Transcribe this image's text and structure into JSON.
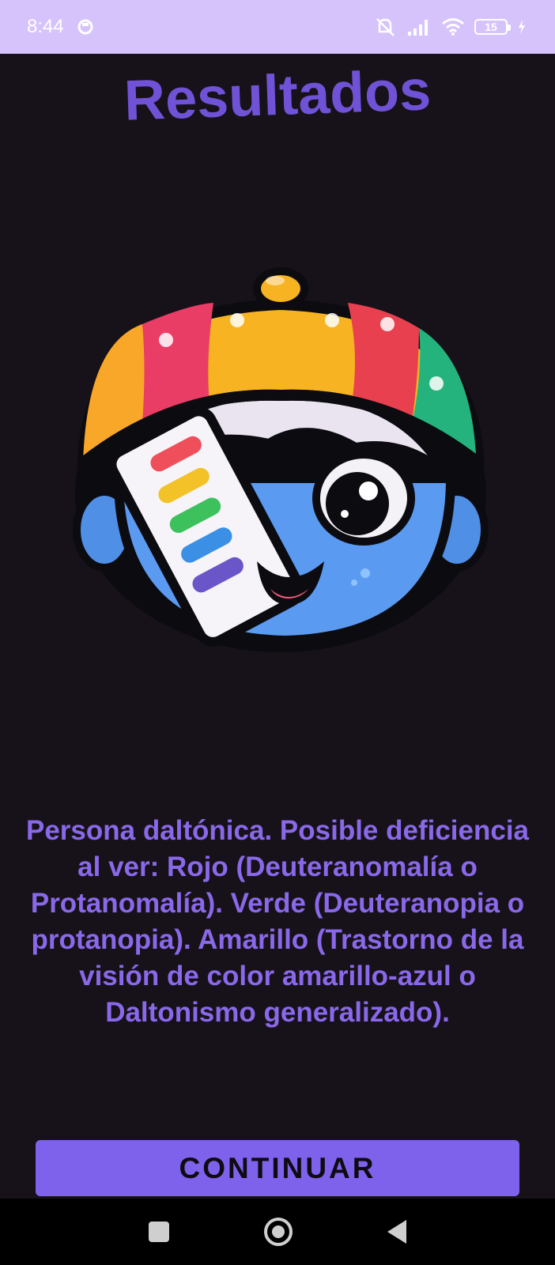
{
  "status_bar": {
    "time": "8:44",
    "battery_level": "15",
    "icons": [
      "notification-circle-icon",
      "mute-icon",
      "signal-icon",
      "wifi-icon",
      "battery-icon",
      "charging-icon"
    ]
  },
  "page": {
    "title": "Resultados",
    "result_text": "Persona daltónica. Posible deficiencia al ver: Rojo (Deuteranomalía o Protanomalía). Verde (Deuteranopia o protanopia). Amarillo (Trastorno de la visión de color amarillo-azul o Daltonismo generalizado).",
    "continue_label": "CONTINUAR"
  },
  "nav_bar": {
    "icons": [
      "recent-apps-icon",
      "home-icon",
      "back-icon"
    ]
  },
  "colors": {
    "background": "#171219",
    "accent": "#7e62ec",
    "title": "#7052d6",
    "status_bar": "#d6c3fb"
  }
}
